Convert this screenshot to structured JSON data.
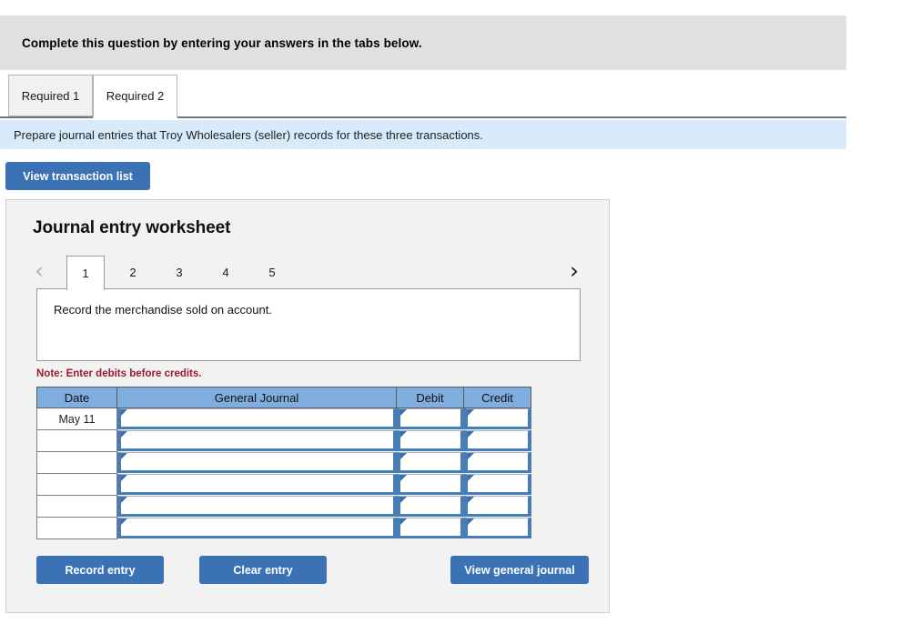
{
  "banner": {
    "text": "Complete this question by entering your answers in the tabs below."
  },
  "required_tabs": [
    {
      "label": "Required 1",
      "active": false
    },
    {
      "label": "Required 2",
      "active": true
    }
  ],
  "requirement": {
    "text": "Prepare journal entries that Troy Wholesalers (seller) records for these three transactions."
  },
  "toolbar": {
    "view_transaction_list_label": "View transaction list"
  },
  "worksheet": {
    "title": "Journal entry worksheet",
    "prev_icon": "‹",
    "next_icon": "›",
    "entry_tabs": [
      {
        "label": "1",
        "active": true
      },
      {
        "label": "2",
        "active": false
      },
      {
        "label": "3",
        "active": false
      },
      {
        "label": "4",
        "active": false
      },
      {
        "label": "5",
        "active": false
      }
    ],
    "entry_description": "Record the merchandise sold on account.",
    "note": "Note: Enter debits before credits.",
    "table": {
      "headers": [
        "Date",
        "General Journal",
        "Debit",
        "Credit"
      ],
      "rows": [
        {
          "date": "May 11",
          "general_journal": "",
          "debit": "",
          "credit": ""
        },
        {
          "date": "",
          "general_journal": "",
          "debit": "",
          "credit": ""
        },
        {
          "date": "",
          "general_journal": "",
          "debit": "",
          "credit": ""
        },
        {
          "date": "",
          "general_journal": "",
          "debit": "",
          "credit": ""
        },
        {
          "date": "",
          "general_journal": "",
          "debit": "",
          "credit": ""
        },
        {
          "date": "",
          "general_journal": "",
          "debit": "",
          "credit": ""
        }
      ]
    },
    "actions": {
      "record_entry_label": "Record entry",
      "clear_entry_label": "Clear entry",
      "view_general_journal_label": "View general journal"
    }
  },
  "colors": {
    "banner_gray": "#e0e0e0",
    "requirement_blue": "#d7ebfa",
    "button_blue": "#3b72b5",
    "table_header_blue": "#7fadde",
    "cell_border_blue": "#4a7cb5",
    "note_red": "#9c1a2c",
    "panel_gray": "#f2f2f2"
  }
}
